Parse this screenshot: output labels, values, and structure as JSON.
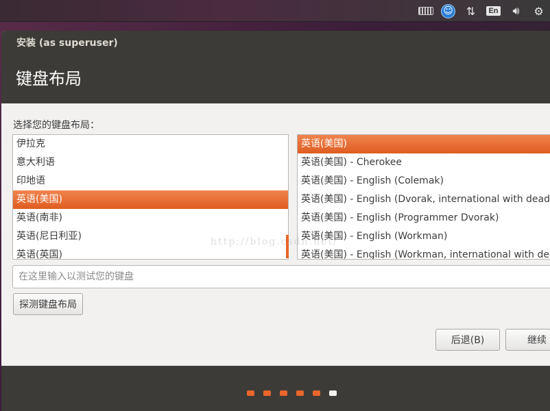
{
  "tray": {
    "icons": [
      "keyboard-icon",
      "accessibility-icon",
      "network-icon",
      "input-method-icon",
      "volume-icon",
      "power-icon"
    ],
    "input_method": "En"
  },
  "window": {
    "title": "安装 (as superuser)",
    "page_title": "键盘布局"
  },
  "main": {
    "prompt": "选择您的键盘布局：",
    "layouts": [
      {
        "label": "伊拉克",
        "selected": false
      },
      {
        "label": "意大利语",
        "selected": false
      },
      {
        "label": "印地语",
        "selected": false
      },
      {
        "label": "英语(美国)",
        "selected": true
      },
      {
        "label": "英语(南非)",
        "selected": false
      },
      {
        "label": "英语(尼日利亚)",
        "selected": false
      },
      {
        "label": "英语(英国)",
        "selected": false
      }
    ],
    "variants": [
      {
        "label": "英语(美国)",
        "selected": true
      },
      {
        "label": "英语(美国) - Cherokee",
        "selected": false
      },
      {
        "label": "英语(美国) - English (Colemak)",
        "selected": false
      },
      {
        "label": "英语(美国) - English (Dvorak, international with dead keys)",
        "selected": false
      },
      {
        "label": "英语(美国) - English (Programmer Dvorak)",
        "selected": false
      },
      {
        "label": "英语(美国) - English (Workman)",
        "selected": false
      },
      {
        "label": "英语(美国) - English (Workman, international with dead keys)",
        "selected": false
      }
    ],
    "test_placeholder": "在这里输入以测试您的键盘",
    "detect_label": "探测键盘布局",
    "back_label": "后退(B)",
    "next_label": "继续"
  },
  "watermark": "http://blog.csdn.net/",
  "progress": {
    "total": 6,
    "current": 6,
    "done_color": "#e8662b",
    "todo_color": "#f2f1f0"
  },
  "colors": {
    "accent": "#e8662b",
    "header_bg": "#3c3b37",
    "body_bg": "#f2f1f0"
  }
}
